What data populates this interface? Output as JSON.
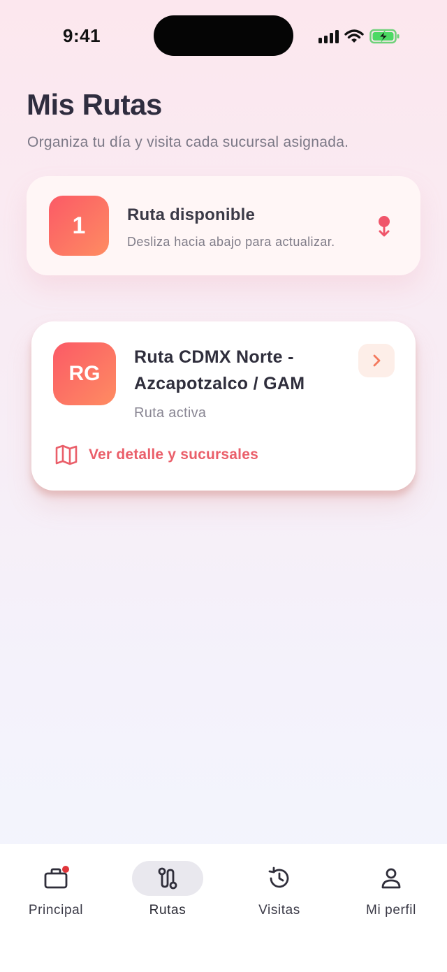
{
  "status_bar": {
    "time": "9:41"
  },
  "header": {
    "title": "Mis Rutas",
    "subtitle": "Organiza tu día y visita cada sucursal asignada."
  },
  "summary": {
    "count": "1",
    "title": "Ruta disponible",
    "hint": "Desliza hacia abajo para actualizar."
  },
  "route": {
    "initials": "RG",
    "name": "Ruta CDMX Norte - Azcapotzalco / GAM",
    "status": "Ruta activa",
    "detail_link": "Ver detalle y sucursales"
  },
  "tabs": [
    {
      "label": "Principal",
      "icon": "briefcase-icon",
      "active": false,
      "has_notification": true
    },
    {
      "label": "Rutas",
      "icon": "route-icon",
      "active": true,
      "has_notification": false
    },
    {
      "label": "Visitas",
      "icon": "history-icon",
      "active": false,
      "has_notification": false
    },
    {
      "label": "Mi perfil",
      "icon": "user-icon",
      "active": false,
      "has_notification": false
    }
  ],
  "colors": {
    "accent": "#ea5f6a",
    "gradient_start": "#fb5a66",
    "gradient_end": "#fe8c62",
    "battery_green": "#4cd964",
    "notification": "#e0353a"
  }
}
